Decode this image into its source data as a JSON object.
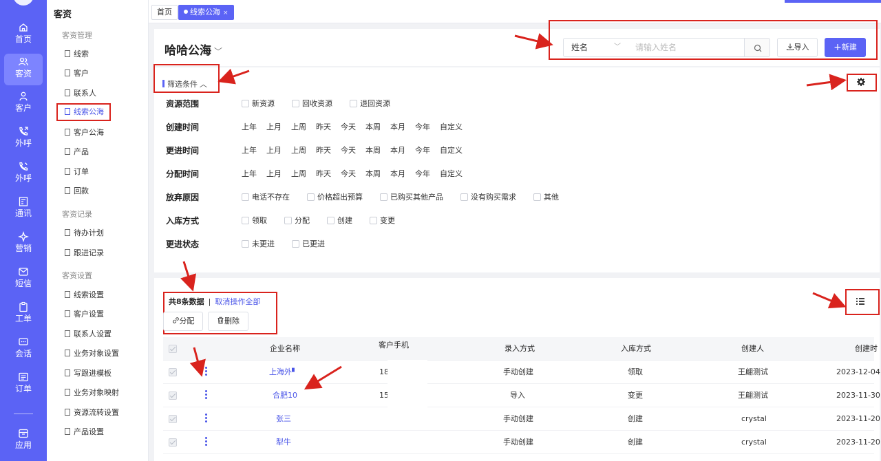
{
  "rail": {
    "items": [
      {
        "label": "首页",
        "icon": "home-icon"
      },
      {
        "label": "客资",
        "icon": "users-icon"
      },
      {
        "label": "客户",
        "icon": "user-icon"
      },
      {
        "label": "外呼",
        "icon": "phone-icon"
      },
      {
        "label": "外呼",
        "icon": "phone-call-icon"
      },
      {
        "label": "通讯",
        "icon": "contacts-icon"
      },
      {
        "label": "营销",
        "icon": "marketing-icon"
      },
      {
        "label": "短信",
        "icon": "message-icon"
      },
      {
        "label": "工单",
        "icon": "clipboard-icon"
      },
      {
        "label": "会话",
        "icon": "chat-icon"
      },
      {
        "label": "订单",
        "icon": "order-icon"
      },
      {
        "label": "应用",
        "icon": "app-icon"
      }
    ],
    "active_index": 1
  },
  "sidebar": {
    "title": "客资",
    "groups": [
      {
        "label": "客资管理",
        "items": [
          "线索",
          "客户",
          "联系人",
          "线索公海",
          "客户公海",
          "产品",
          "订单",
          "回款"
        ]
      },
      {
        "label": "客资记录",
        "items": [
          "待办计划",
          "跟进记录"
        ]
      },
      {
        "label": "客资设置",
        "items": [
          "线索设置",
          "客户设置",
          "联系人设置",
          "业务对象设置",
          "写跟进模板",
          "业务对象映射",
          "资源流转设置",
          "产品设置"
        ]
      }
    ],
    "active_item": "线索公海"
  },
  "tabs": [
    {
      "label": "首页",
      "active": false
    },
    {
      "label": "线索公海",
      "active": true,
      "close": "×"
    }
  ],
  "header": {
    "title": "哈哈公海",
    "search_field": "姓名",
    "search_placeholder": "请输入姓名",
    "import_label": "导入",
    "new_label": "新建"
  },
  "filters": {
    "toggle_label": "筛选条件",
    "rows": [
      {
        "label": "资源范围",
        "type": "checkbox",
        "options": [
          "新资源",
          "回收资源",
          "退回资源"
        ]
      },
      {
        "label": "创建时间",
        "type": "text",
        "options": [
          "上年",
          "上月",
          "上周",
          "昨天",
          "今天",
          "本周",
          "本月",
          "今年",
          "自定义"
        ]
      },
      {
        "label": "更进时间",
        "type": "text",
        "options": [
          "上年",
          "上月",
          "上周",
          "昨天",
          "今天",
          "本周",
          "本月",
          "今年",
          "自定义"
        ]
      },
      {
        "label": "分配时间",
        "type": "text",
        "options": [
          "上年",
          "上月",
          "上周",
          "昨天",
          "今天",
          "本周",
          "本月",
          "今年",
          "自定义"
        ]
      },
      {
        "label": "放弃原因",
        "type": "checkbox",
        "options": [
          "电话不存在",
          "价格超出预算",
          "已购买其他产品",
          "没有购买需求",
          "其他"
        ]
      },
      {
        "label": "入库方式",
        "type": "checkbox",
        "options": [
          "领取",
          "分配",
          "创建",
          "变更"
        ]
      },
      {
        "label": "更进状态",
        "type": "checkbox",
        "options": [
          "未更进",
          "已更进"
        ]
      }
    ]
  },
  "list": {
    "count_text": "共8条数据",
    "separator": "|",
    "cancel_all": "取消操作全部",
    "assign_label": "分配",
    "delete_label": "删除",
    "columns": [
      "企业名称",
      "客户手机",
      "录入方式",
      "入库方式",
      "创建人",
      "创建时"
    ],
    "rows": [
      {
        "name": "上海外",
        "phone": "18",
        "entry": "手动创建",
        "storage": "领取",
        "creator": "王翩测试",
        "created": "2023-12-04"
      },
      {
        "name": "合肥10",
        "phone": "15",
        "entry": "导入",
        "storage": "变更",
        "creator": "王翩测试",
        "created": "2023-11-30"
      },
      {
        "name": "张三",
        "phone": "",
        "entry": "手动创建",
        "storage": "创建",
        "creator": "crystal",
        "created": "2023-11-20"
      },
      {
        "name": "犁牛",
        "phone": "",
        "entry": "手动创建",
        "storage": "创建",
        "creator": "crystal",
        "created": "2023-11-20"
      }
    ]
  },
  "colors": {
    "accent": "#5b63f5",
    "annotation": "#d9231d"
  }
}
